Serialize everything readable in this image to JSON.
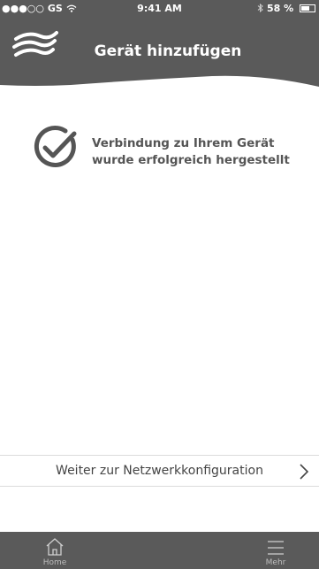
{
  "status_bar": {
    "carrier": "●●●○○ GS",
    "time": "9:41 AM",
    "battery": "58 %",
    "battery_level": 0.58,
    "bluetooth_icon": "bluetooth-icon",
    "wifi_icon": "wifi-icon"
  },
  "header": {
    "title": "Gerät hinzufügen",
    "logo_icon": "wave-logo-icon",
    "background_color": "#5a5a5a"
  },
  "content": {
    "success_icon": "check-circle-icon",
    "message": "Verbindung zu Ihrem Gerät wurde erfolgreich hergestellt"
  },
  "next_row": {
    "label": "Weiter zur Netzwerkkonfiguration",
    "icon": "chevron-right-icon"
  },
  "tab_bar": {
    "items": [
      {
        "label": "Home",
        "icon": "home-icon"
      },
      {
        "label": "Mehr",
        "icon": "menu-icon"
      }
    ]
  }
}
